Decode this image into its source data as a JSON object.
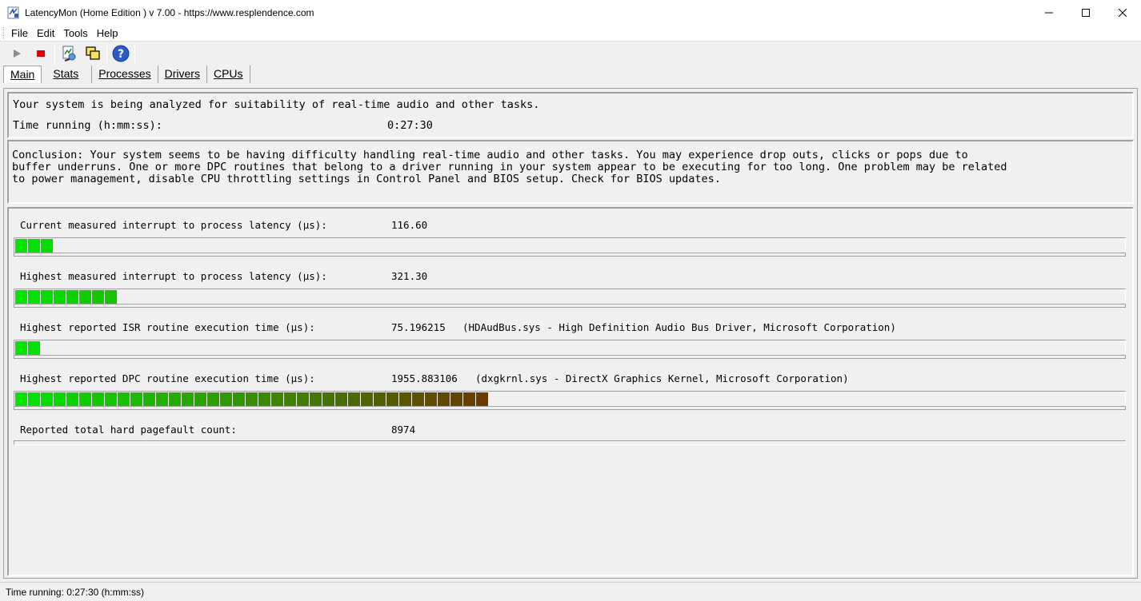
{
  "window": {
    "title": "LatencyMon  (Home Edition )  v 7.00 - https://www.resplendence.com"
  },
  "menu": {
    "items": [
      "File",
      "Edit",
      "Tools",
      "Help"
    ]
  },
  "toolbar": {
    "buttons": [
      "play-icon",
      "stop-icon",
      "report-icon",
      "copy-icon",
      "help-icon"
    ]
  },
  "tabs": [
    "Main",
    "Stats",
    "Processes",
    "Drivers",
    "CPUs"
  ],
  "status_panel": {
    "line1": "Your system is being analyzed for suitability of real-time audio and other tasks.",
    "time_label": "Time running (h:mm:ss):",
    "time_value": "0:27:30"
  },
  "conclusion": {
    "line1": "Conclusion: Your system seems to be having difficulty handling real-time audio and other tasks. You may experience drop outs, clicks or pops due to",
    "line2": "buffer underruns. One or more DPC routines that belong to a driver running in your system appear to be executing for too long. One problem may be related",
    "line3": "to power management, disable CPU throttling settings in Control Panel and BIOS setup. Check for BIOS updates."
  },
  "metrics": [
    {
      "label": "Current measured interrupt to process latency (µs):",
      "value": "116.60",
      "detail": "",
      "segments": 3
    },
    {
      "label": "Highest measured interrupt to process latency (µs):",
      "value": "321.30",
      "detail": "",
      "segments": 8
    },
    {
      "label": "Highest reported ISR routine execution time (µs):",
      "value": "75.196215",
      "detail": "(HDAudBus.sys - High Definition Audio Bus Driver, Microsoft Corporation)",
      "segments": 2
    },
    {
      "label": "Highest reported DPC routine execution time (µs):",
      "value": "1955.883106",
      "detail": "(dxgkrnl.sys - DirectX Graphics Kernel, Microsoft Corporation)",
      "segments": 37
    }
  ],
  "pagefault": {
    "label": "Reported total hard pagefault count:",
    "value": "8974"
  },
  "statusbar": {
    "text": "Time running: 0:27:30  (h:mm:ss)"
  },
  "colors": {
    "bar_start": "#00e600",
    "bar_end": "#6b3a00"
  }
}
